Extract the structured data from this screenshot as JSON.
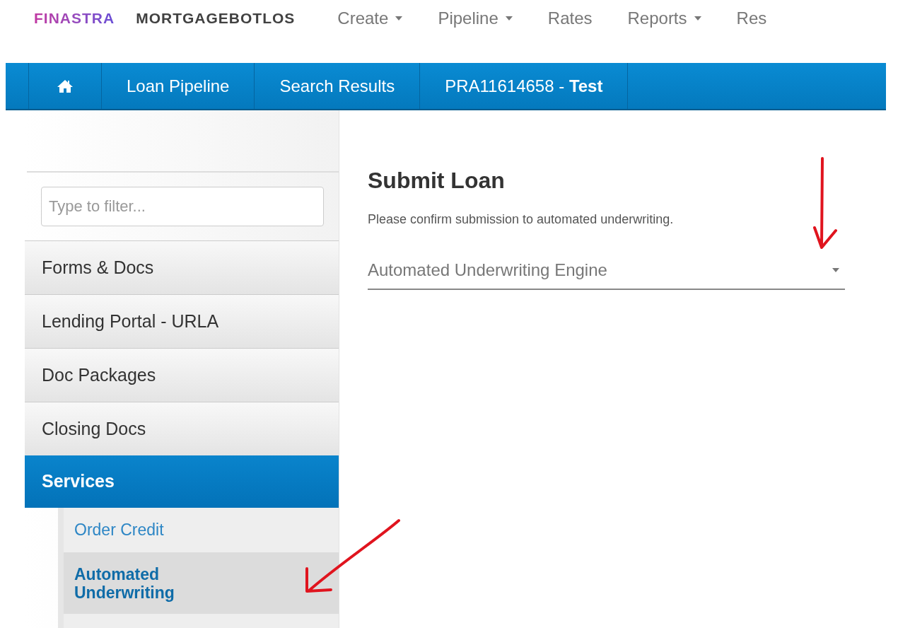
{
  "brand": {
    "company": "FINASTRA",
    "product": "MORTGAGEBOTLOS"
  },
  "top_menu": [
    {
      "label": "Create",
      "has_menu": true
    },
    {
      "label": "Pipeline",
      "has_menu": true
    },
    {
      "label": "Rates",
      "has_menu": false
    },
    {
      "label": "Reports",
      "has_menu": true
    },
    {
      "label": "Res",
      "has_menu": false
    }
  ],
  "breadcrumbs": [
    {
      "kind": "home"
    },
    {
      "kind": "text",
      "label": "Loan Pipeline"
    },
    {
      "kind": "text",
      "label": "Search Results"
    },
    {
      "kind": "text",
      "label": "PRA11614658 - **Test**"
    }
  ],
  "sidebar": {
    "filter": {
      "placeholder": "Type to filter..."
    },
    "items": [
      {
        "label": "Forms & Docs",
        "selected": false
      },
      {
        "label": "Lending Portal - URLA",
        "selected": false
      },
      {
        "label": "Doc Packages",
        "selected": false
      },
      {
        "label": "Closing Docs",
        "selected": false
      },
      {
        "label": "Services",
        "selected": true,
        "children": [
          {
            "label": "Order Credit",
            "selected": false
          },
          {
            "label": "Automated Underwriting",
            "selected": true
          },
          {
            "selected": false
          }
        ]
      }
    ]
  },
  "main": {
    "title": "Submit Loan",
    "description": "Please confirm submission to automated underwriting.",
    "select": {
      "placeholder": "Automated Underwriting Engine"
    }
  },
  "annotations": [
    {
      "kind": "down-arrow"
    },
    {
      "kind": "diagonal-arrow"
    }
  ]
}
